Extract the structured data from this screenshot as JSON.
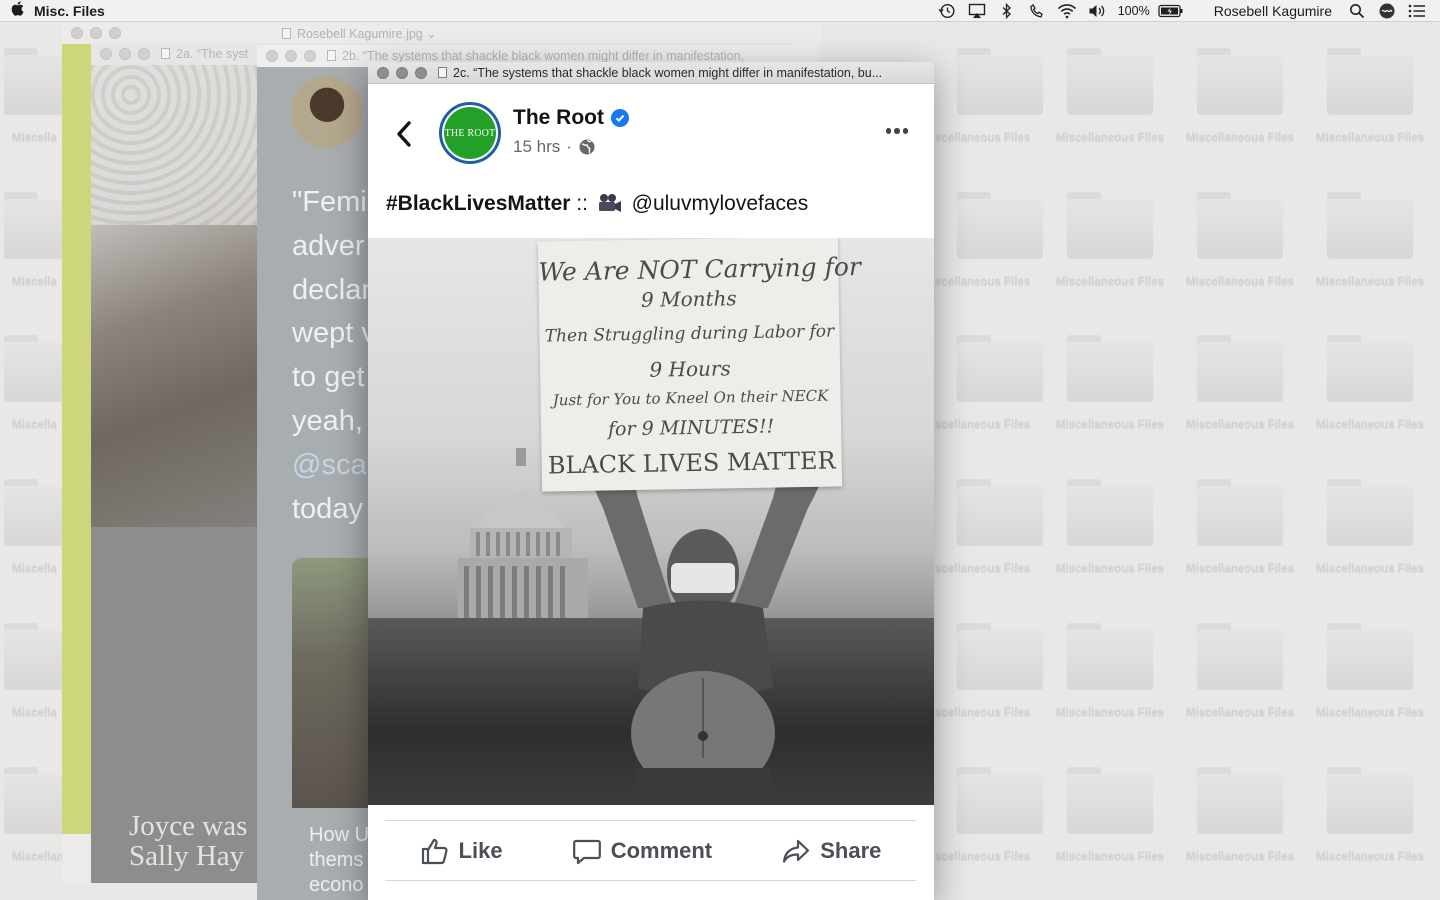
{
  "menubar": {
    "app_name": "Misc. Files",
    "battery": "100%",
    "user": "Rosebell Kagumire"
  },
  "desktop": {
    "folder_label": "Miscellaneous Files",
    "folder_label_left": "Miscella",
    "folder_label_left_bottom": "Miscellaneou",
    "folder_label_right_partial": "scellaneous Files"
  },
  "windows": {
    "a": {
      "title": "Rosebell Kagumire.jpg"
    },
    "b": {
      "title": "2a. “The syst",
      "caption_line1": "Joyce was",
      "caption_line2": "Sally Hay"
    },
    "c": {
      "title": "2b. “The systems that shackle black women might differ in manifestation,",
      "lines": [
        "\"Femi",
        "adver",
        "declar",
        "wept v",
        "to get",
        "yeah,",
        "@sca",
        "today"
      ],
      "link_line1": "How U",
      "link_line2": "thems",
      "link_line3": "econo"
    },
    "front": {
      "title": "2c. “The systems that shackle black women might differ in manifestation, bu..."
    }
  },
  "post": {
    "page_name": "The Root",
    "avatar_text": "THE ROOT",
    "time": "15 hrs",
    "dot": "·",
    "hashtag": "#BlackLivesMatter",
    "separator": "::",
    "handle": "@uluvmylovefaces",
    "sign_lines": [
      "We Are NOT Carrying for",
      "9 Months",
      "Then Struggling during Labor for",
      "9 Hours",
      "Just for You to Kneel On their NECK",
      "for 9 MINUTES!!",
      "BLACK LIVES MATTER"
    ],
    "actions": {
      "like": "Like",
      "comment": "Comment",
      "share": "Share"
    }
  },
  "colors": {
    "verified_blue": "#1877f2",
    "root_green": "#22a028",
    "action_gray": "#4b4f56"
  }
}
